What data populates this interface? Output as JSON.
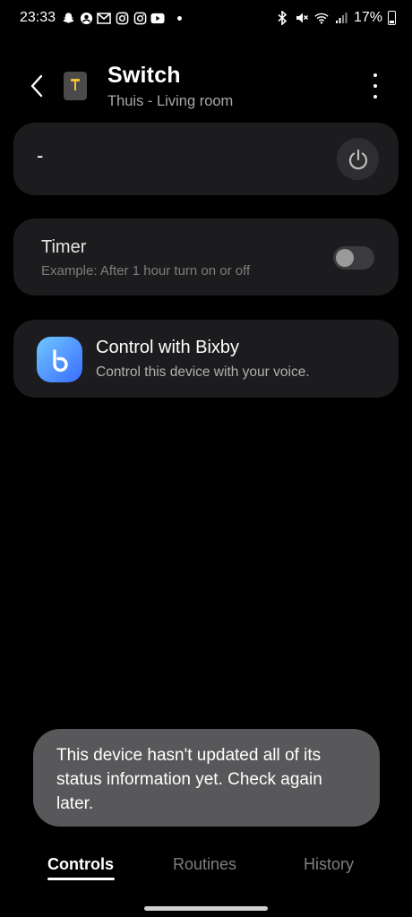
{
  "status_bar": {
    "time": "23:33",
    "battery_text": "17%",
    "left_icons": [
      "snapchat-icon",
      "account-icon",
      "gmail-icon",
      "instagram-icon",
      "instagram-icon",
      "youtube-icon"
    ],
    "right_icons": [
      "bluetooth-icon",
      "mute-icon",
      "wifi-icon",
      "signal-icon",
      "battery-icon"
    ]
  },
  "header": {
    "title": "Switch",
    "subtitle": "Thuis - Living room",
    "accent_color": "#f4c430"
  },
  "power_card": {
    "state": "-"
  },
  "timer_card": {
    "title": "Timer",
    "subtitle": "Example: After 1 hour turn on or off",
    "toggle_on": false
  },
  "bixby_card": {
    "title": "Control with Bixby",
    "subtitle": "Control this device with your voice."
  },
  "toast": {
    "message": "This device hasn't updated all of its status information yet. Check again later."
  },
  "tabs": [
    {
      "label": "Controls",
      "active": true
    },
    {
      "label": "Routines",
      "active": false
    },
    {
      "label": "History",
      "active": false
    }
  ]
}
